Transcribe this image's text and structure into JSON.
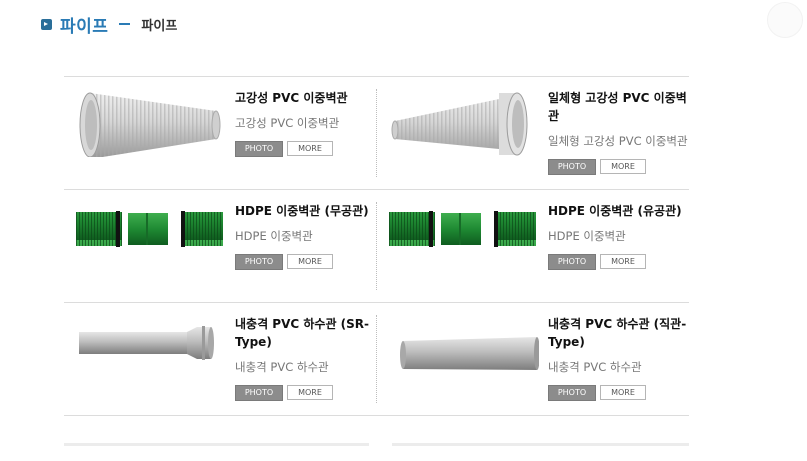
{
  "header": {
    "title": "파이프",
    "subtitle": "파이프"
  },
  "buttons": {
    "photo": "PHOTO",
    "more": "MORE"
  },
  "products": [
    {
      "name": "고강성 PVC 이중벽관",
      "desc": "고강성 PVC 이중벽관",
      "image": "corrugated-white-pipe"
    },
    {
      "name": "일체형 고강성 PVC 이중벽관",
      "desc": "일체형 고강성 PVC 이중벽관",
      "image": "corrugated-white-pipe-flared"
    },
    {
      "name": "HDPE 이중벽관 (무공관)",
      "desc": "HDPE 이중벽관",
      "image": "green-hdpe-pipe"
    },
    {
      "name": "HDPE 이중벽관 (유공관)",
      "desc": "HDPE 이중벽관",
      "image": "green-hdpe-pipe-perforated"
    },
    {
      "name": "내충격 PVC 하수관 (SR-Type)",
      "desc": "내충격 PVC 하수관",
      "image": "grey-sr-pipe"
    },
    {
      "name": "내충격 PVC 하수관 (직관-Type)",
      "desc": "내충격 PVC 하수관",
      "image": "grey-straight-pipe"
    }
  ]
}
